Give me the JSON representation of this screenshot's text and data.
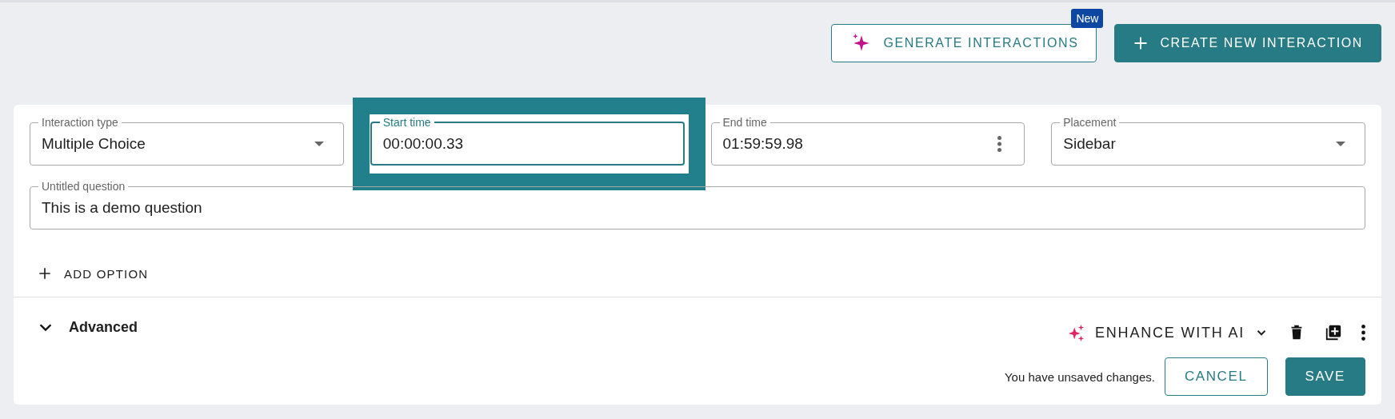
{
  "header_actions": {
    "generate_button": {
      "label": "GENERATE INTERACTIONS",
      "badge": "New"
    },
    "create_button": {
      "label": "CREATE NEW INTERACTION"
    }
  },
  "fields": [
    {
      "kind": "select",
      "label": "Interaction type",
      "value": "Multiple Choice",
      "focused": false,
      "highlighted": false
    },
    {
      "kind": "text",
      "label": "Start time",
      "value": "00:00:00.33",
      "focused": true,
      "highlighted": true
    },
    {
      "kind": "time",
      "label": "End time",
      "value": "01:59:59.98",
      "focused": false,
      "highlighted": false
    },
    {
      "kind": "select",
      "label": "Placement",
      "value": "Sidebar",
      "focused": false,
      "highlighted": false
    }
  ],
  "question": {
    "label": "Untitled question",
    "value": "This is a demo question"
  },
  "add_option": {
    "label": "ADD OPTION"
  },
  "advanced": {
    "label": "Advanced",
    "expanded": false
  },
  "enhance_button": {
    "label": "ENHANCE WITH AI"
  },
  "status_text": "You have unsaved changes.",
  "footer_buttons": [
    {
      "kind": "outlined",
      "label": "CANCEL"
    },
    {
      "kind": "filled",
      "label": "SAVE"
    }
  ]
}
